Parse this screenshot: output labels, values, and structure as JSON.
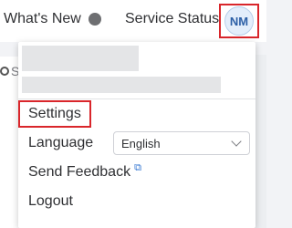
{
  "topbar": {
    "whats_new_label": "What's New",
    "service_status_label": "Service Status",
    "avatar_initials": "NM"
  },
  "background": {
    "search_fragment": "S"
  },
  "menu": {
    "settings_label": "Settings",
    "language_label": "Language",
    "language_value": "English",
    "send_feedback_label": "Send Feedback",
    "logout_label": "Logout"
  },
  "icons": {
    "status_dot": "dot-icon",
    "external_link": "external-link-icon",
    "chevron": "chevron-down-icon"
  },
  "colors": {
    "highlight_border": "#d9262b",
    "avatar_bg": "#e3eefb",
    "avatar_text": "#2b5fa6",
    "link_icon": "#2f73d0"
  }
}
